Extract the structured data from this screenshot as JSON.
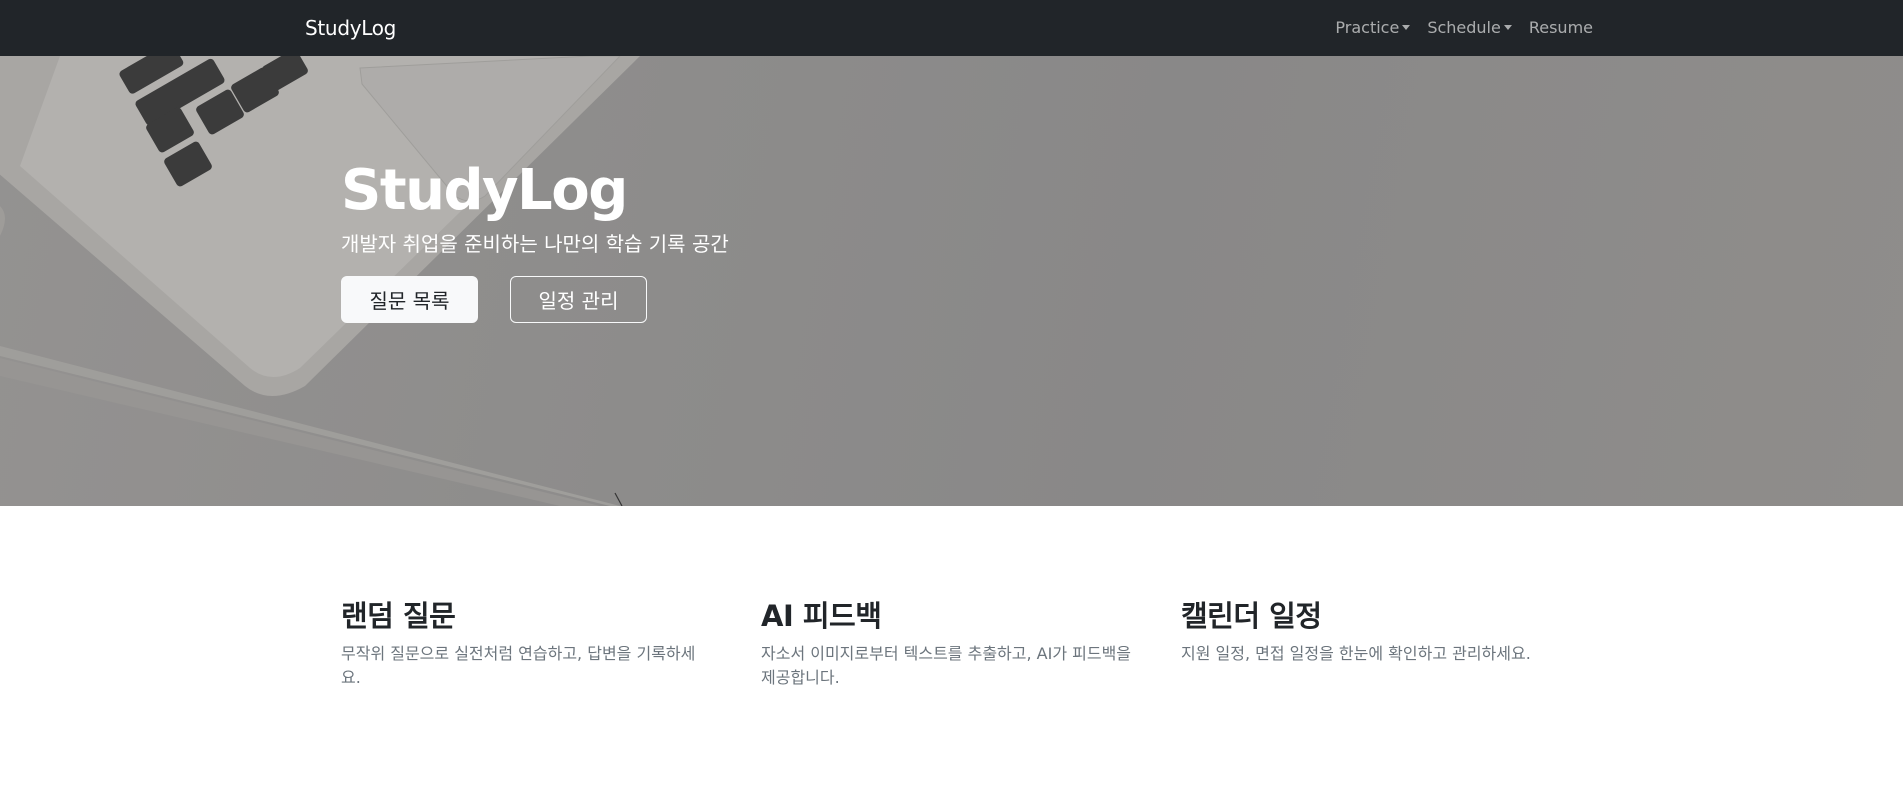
{
  "navbar": {
    "brand": "StudyLog",
    "items": [
      {
        "label": "Practice",
        "dropdown": true
      },
      {
        "label": "Schedule",
        "dropdown": true
      },
      {
        "label": "Resume",
        "dropdown": false
      }
    ]
  },
  "hero": {
    "title": "StudyLog",
    "subtitle": "개발자 취업을 준비하는 나만의 학습 기록 공간",
    "primary_button": "질문 목록",
    "secondary_button": "일정 관리"
  },
  "features": [
    {
      "title": "랜덤 질문",
      "description": "무작위 질문으로 실전처럼 연습하고, 답변을 기록하세요."
    },
    {
      "title": "AI 피드백",
      "description": "자소서 이미지로부터 텍스트를 추출하고, AI가 피드백을 제공합니다."
    },
    {
      "title": "캘린더 일정",
      "description": "지원 일정, 면접 일정을 한눈에 확인하고 관리하세요."
    }
  ],
  "colors": {
    "navbar_bg": "#212529",
    "hero_overlay": "#939291",
    "text_muted": "#6c757d"
  }
}
